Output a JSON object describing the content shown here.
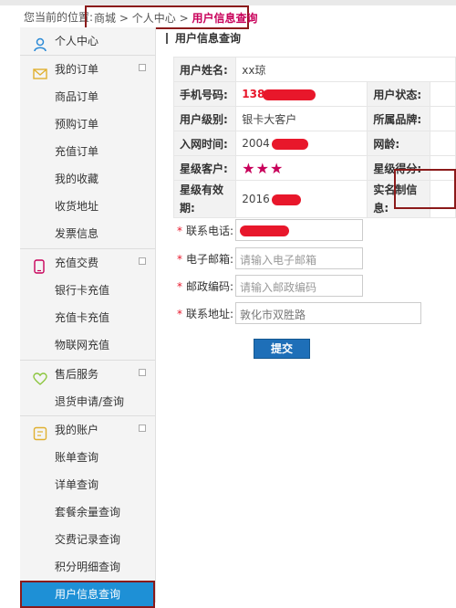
{
  "breadcrumb": {
    "prefix": "您当前的位置:",
    "items": [
      "商城",
      ">",
      "个人中心",
      ">"
    ],
    "current": "用户信息查询"
  },
  "sidebar": {
    "home": "个人中心",
    "sections": [
      {
        "title": "我的订单",
        "icon": "envelope-icon",
        "items": [
          "商品订单",
          "预购订单",
          "充值订单",
          "我的收藏",
          "收货地址",
          "发票信息"
        ]
      },
      {
        "title": "充值交费",
        "icon": "phone-icon",
        "items": [
          "银行卡充值",
          "充值卡充值",
          "物联网充值"
        ]
      },
      {
        "title": "售后服务",
        "icon": "heart-icon",
        "items": [
          "退货申请/查询"
        ]
      },
      {
        "title": "我的账户",
        "icon": "account-icon",
        "items": [
          "账单查询",
          "详单查询",
          "套餐余量查询",
          "交费记录查询",
          "积分明细查询",
          "用户信息查询"
        ]
      }
    ],
    "active_item": "用户信息查询"
  },
  "main": {
    "title": "用户信息查询",
    "table": {
      "name_label": "用户姓名:",
      "name_value": "xx琼",
      "phone_label": "手机号码:",
      "phone_value": "138",
      "status_label": "用户状态:",
      "level_label": "用户级别:",
      "level_value": "银卡大客户",
      "brand_label": "所属品牌:",
      "join_label": "入网时间:",
      "join_value": "2004",
      "age_label": "网龄:",
      "star_label": "星级客户:",
      "star_value": "★★★",
      "score_label": "星级得分:",
      "valid_label_1": "星级有效",
      "valid_label_2": "期:",
      "valid_value": "2016",
      "realname_label_1": "实名制信",
      "realname_label_2": "息:"
    },
    "form": {
      "contact_phone_label": "联系电话:",
      "email_label": "电子邮箱:",
      "email_placeholder": "请输入电子邮箱",
      "zip_label": "邮政编码:",
      "zip_placeholder": "请输入邮政编码",
      "address_label": "联系地址:",
      "address_value": "敦化市双胜路",
      "required_mark": "*"
    },
    "submit_label": "提交"
  },
  "colors": {
    "accent": "#1e90d6",
    "highlight_box": "#8b1a1a",
    "redaction": "#e8172b",
    "star": "#c8005a"
  }
}
